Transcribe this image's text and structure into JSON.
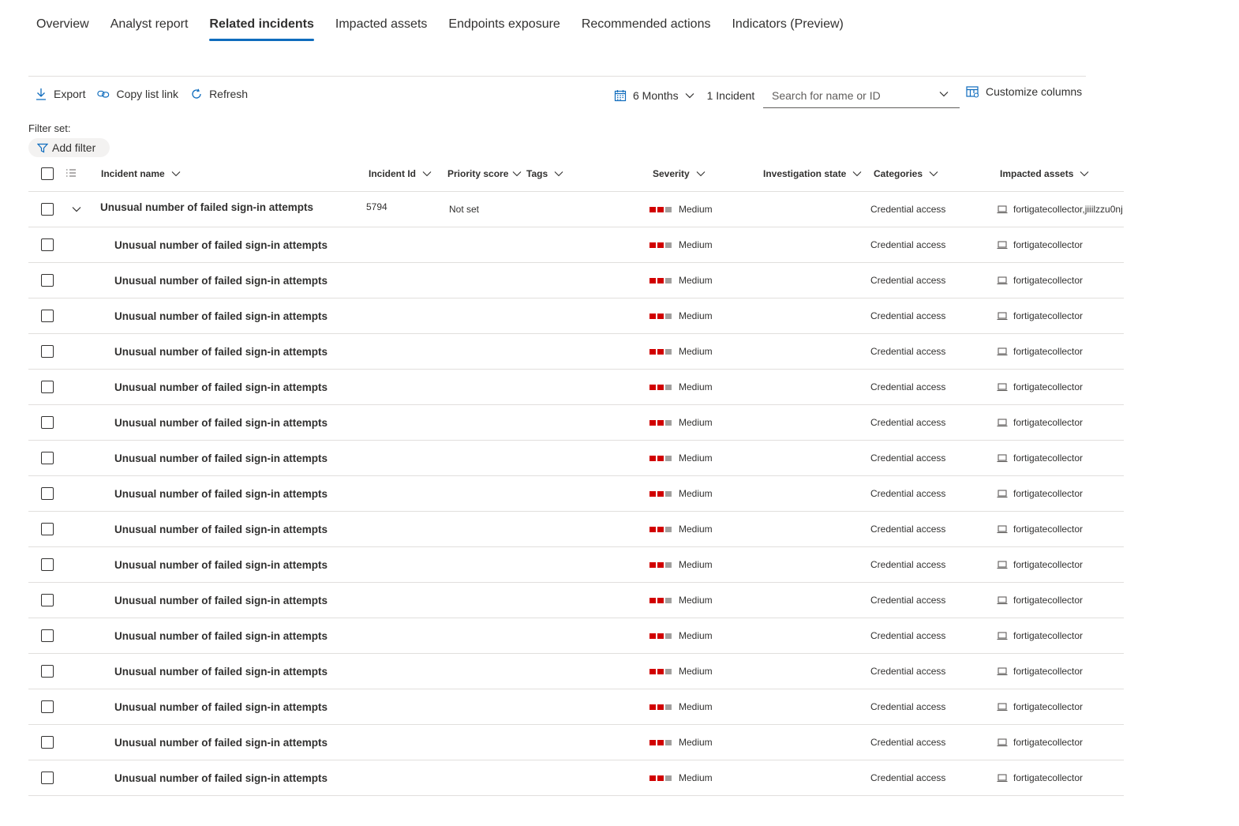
{
  "tabs": [
    {
      "label": "Overview",
      "active": false
    },
    {
      "label": "Analyst report",
      "active": false
    },
    {
      "label": "Related incidents",
      "active": true
    },
    {
      "label": "Impacted assets",
      "active": false
    },
    {
      "label": "Endpoints exposure",
      "active": false
    },
    {
      "label": "Recommended actions",
      "active": false
    },
    {
      "label": "Indicators (Preview)",
      "active": false
    }
  ],
  "toolbar": {
    "export_label": "Export",
    "copy_link_label": "Copy list link",
    "refresh_label": "Refresh",
    "time_range_label": "6 Months",
    "count_label": "1 Incident",
    "search_placeholder": "Search for name or ID",
    "customize_label": "Customize columns"
  },
  "filter": {
    "label": "Filter set:",
    "add_filter_label": "Add filter"
  },
  "columns": {
    "incident_name": "Incident name",
    "incident_id": "Incident Id",
    "priority_score": "Priority score",
    "tags": "Tags",
    "severity": "Severity",
    "investigation_state": "Investigation state",
    "categories": "Categories",
    "impacted_assets": "Impacted assets"
  },
  "colors": {
    "accent": "#0f6cbd",
    "severity_filled": "#d13438",
    "severity_empty": "#a19f9d"
  },
  "parent_row": {
    "name": "Unusual number of failed sign-in attempts",
    "id": "5794",
    "priority": "Not set",
    "severity": "Medium",
    "category": "Credential access",
    "asset": "fortigatecollector,jiiilzzu0nj"
  },
  "child_rows": [
    {
      "name": "Unusual number of failed sign-in attempts",
      "severity": "Medium",
      "category": "Credential access",
      "asset": "fortigatecollector"
    },
    {
      "name": "Unusual number of failed sign-in attempts",
      "severity": "Medium",
      "category": "Credential access",
      "asset": "fortigatecollector"
    },
    {
      "name": "Unusual number of failed sign-in attempts",
      "severity": "Medium",
      "category": "Credential access",
      "asset": "fortigatecollector"
    },
    {
      "name": "Unusual number of failed sign-in attempts",
      "severity": "Medium",
      "category": "Credential access",
      "asset": "fortigatecollector"
    },
    {
      "name": "Unusual number of failed sign-in attempts",
      "severity": "Medium",
      "category": "Credential access",
      "asset": "fortigatecollector"
    },
    {
      "name": "Unusual number of failed sign-in attempts",
      "severity": "Medium",
      "category": "Credential access",
      "asset": "fortigatecollector"
    },
    {
      "name": "Unusual number of failed sign-in attempts",
      "severity": "Medium",
      "category": "Credential access",
      "asset": "fortigatecollector"
    },
    {
      "name": "Unusual number of failed sign-in attempts",
      "severity": "Medium",
      "category": "Credential access",
      "asset": "fortigatecollector"
    },
    {
      "name": "Unusual number of failed sign-in attempts",
      "severity": "Medium",
      "category": "Credential access",
      "asset": "fortigatecollector"
    },
    {
      "name": "Unusual number of failed sign-in attempts",
      "severity": "Medium",
      "category": "Credential access",
      "asset": "fortigatecollector"
    },
    {
      "name": "Unusual number of failed sign-in attempts",
      "severity": "Medium",
      "category": "Credential access",
      "asset": "fortigatecollector"
    },
    {
      "name": "Unusual number of failed sign-in attempts",
      "severity": "Medium",
      "category": "Credential access",
      "asset": "fortigatecollector"
    },
    {
      "name": "Unusual number of failed sign-in attempts",
      "severity": "Medium",
      "category": "Credential access",
      "asset": "fortigatecollector"
    },
    {
      "name": "Unusual number of failed sign-in attempts",
      "severity": "Medium",
      "category": "Credential access",
      "asset": "fortigatecollector"
    },
    {
      "name": "Unusual number of failed sign-in attempts",
      "severity": "Medium",
      "category": "Credential access",
      "asset": "fortigatecollector"
    },
    {
      "name": "Unusual number of failed sign-in attempts",
      "severity": "Medium",
      "category": "Credential access",
      "asset": "fortigatecollector"
    }
  ]
}
